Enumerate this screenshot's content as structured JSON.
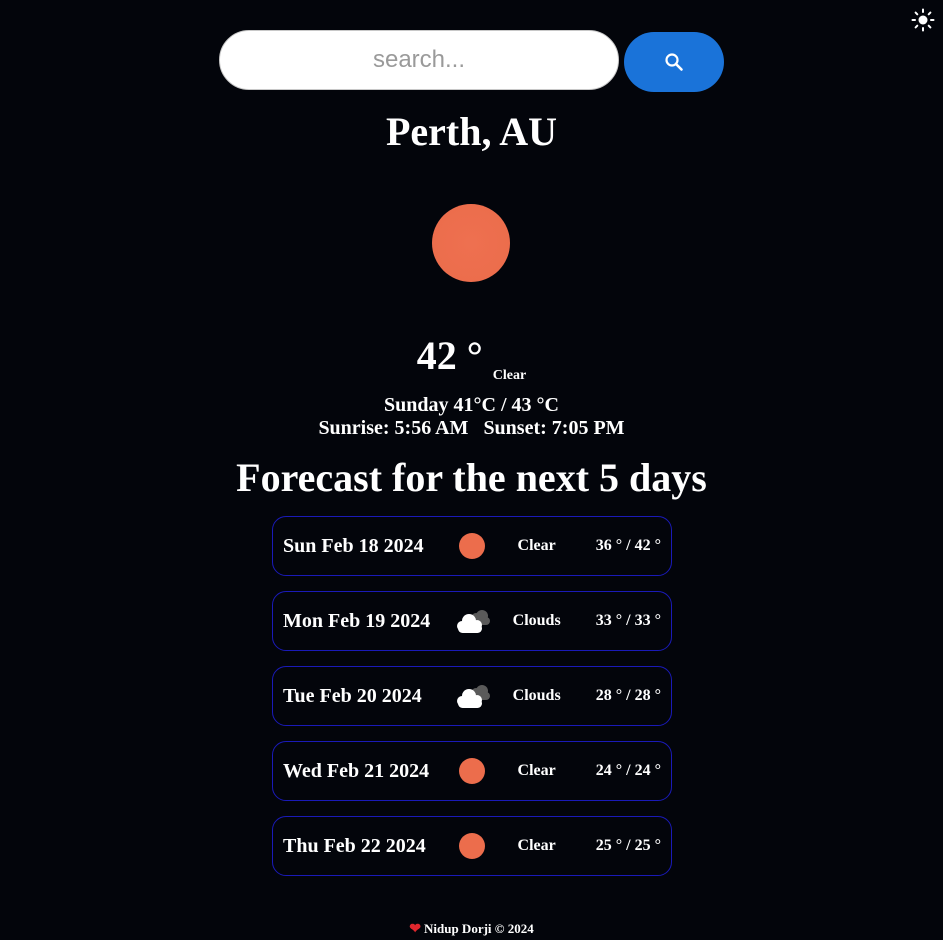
{
  "search": {
    "placeholder": "search...",
    "value": "",
    "button_icon": "search-icon"
  },
  "theme_toggle": {
    "icon": "sun-icon"
  },
  "current": {
    "city": "Perth, AU",
    "icon": "sun-icon",
    "icon_color": "#ec6d4c",
    "temperature": "42 °",
    "condition": "Clear",
    "day_range": "Sunday 41°C / 43 °C",
    "sunrise": "Sunrise: 5:56 AM",
    "sunset": "Sunset: 7:05 PM"
  },
  "forecast": {
    "title": "Forecast for the next 5 days",
    "days": [
      {
        "date": "Sun Feb 18 2024",
        "icon": "sun-icon",
        "condition": "Clear",
        "range": "36 ° / 42 °"
      },
      {
        "date": "Mon Feb 19 2024",
        "icon": "cloud-icon",
        "condition": "Clouds",
        "range": "33 ° / 33 °"
      },
      {
        "date": "Tue Feb 20 2024",
        "icon": "cloud-icon",
        "condition": "Clouds",
        "range": "28 ° / 28 °"
      },
      {
        "date": "Wed Feb 21 2024",
        "icon": "sun-icon",
        "condition": "Clear",
        "range": "24 ° / 24 °"
      },
      {
        "date": "Thu Feb 22 2024",
        "icon": "sun-icon",
        "condition": "Clear",
        "range": "25 ° / 25 °"
      }
    ]
  },
  "footer": {
    "text": "Nidup Dorji © 2024",
    "icon": "heart-icon"
  },
  "colors": {
    "background": "#03050b",
    "accent": "#1a73d9",
    "card_border": "#1a1ab8",
    "sun": "#ec6d4c"
  }
}
